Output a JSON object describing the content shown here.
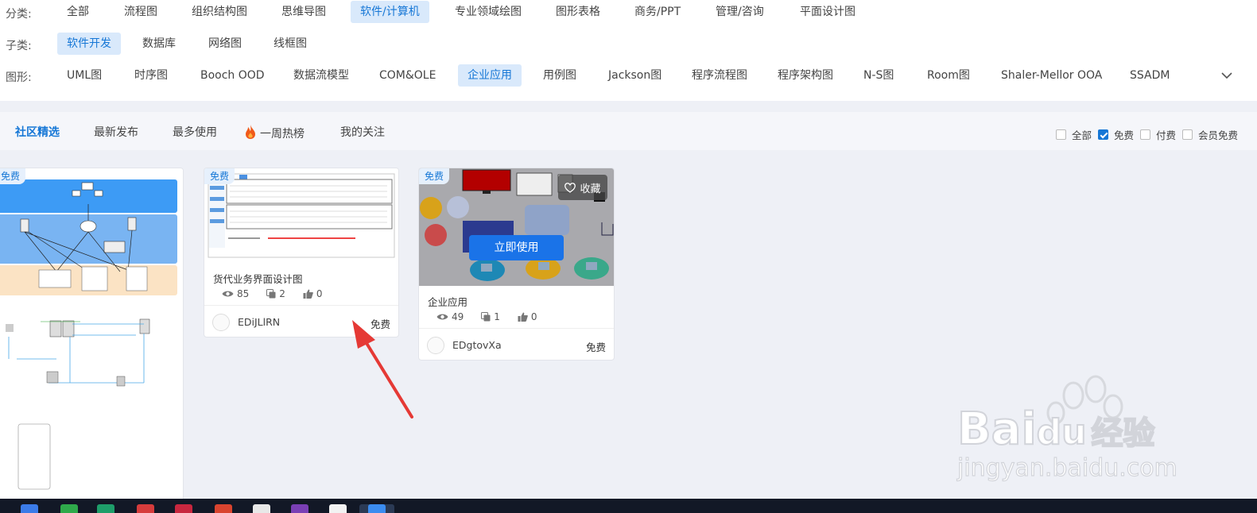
{
  "filters": {
    "category": {
      "label": "分类:",
      "items": [
        "全部",
        "流程图",
        "组织结构图",
        "思维导图",
        "软件/计算机",
        "专业领域绘图",
        "图形表格",
        "商务/PPT",
        "管理/咨询",
        "平面设计图"
      ],
      "active": "软件/计算机"
    },
    "subcategory": {
      "label": "子类:",
      "items": [
        "软件开发",
        "数据库",
        "网络图",
        "线框图"
      ],
      "active": "软件开发"
    },
    "shape": {
      "label": "图形:",
      "items": [
        "UML图",
        "时序图",
        "Booch OOD",
        "数据流模型",
        "COM&OLE",
        "企业应用",
        "用例图",
        "Jackson图",
        "程序流程图",
        "程序架构图",
        "N-S图",
        "Room图",
        "Shaler-Mellor OOA",
        "SSADM"
      ],
      "active": "企业应用"
    }
  },
  "tabs": {
    "items": [
      "社区精选",
      "最新发布",
      "最多使用",
      "一周热榜",
      "我的关注"
    ],
    "active": "社区精选"
  },
  "price_filter": [
    {
      "label": "全部",
      "checked": false
    },
    {
      "label": "免费",
      "checked": true
    },
    {
      "label": "付费",
      "checked": false
    },
    {
      "label": "会员免费",
      "checked": false
    }
  ],
  "cards": [
    {
      "badge": "免费"
    },
    {
      "badge": "免费",
      "title": "货代业务界面设计图",
      "views": "85",
      "copies": "2",
      "likes": "0",
      "author": "EDiJLlRN",
      "price": "免费"
    },
    {
      "badge": "免费",
      "title": "企业应用",
      "views": "49",
      "copies": "1",
      "likes": "0",
      "author": "EDgtovXa",
      "price": "免费",
      "favorite_label": "收藏",
      "use_label": "立即使用"
    }
  ],
  "watermark": {
    "brand": "Bai",
    "brand2": "du",
    "suffix": "经验",
    "url": "jingyan.baidu.com"
  },
  "colors": {
    "accent": "#1677d6",
    "active_chip_bg": "#d9e9fb",
    "arrow": "#e53935"
  }
}
